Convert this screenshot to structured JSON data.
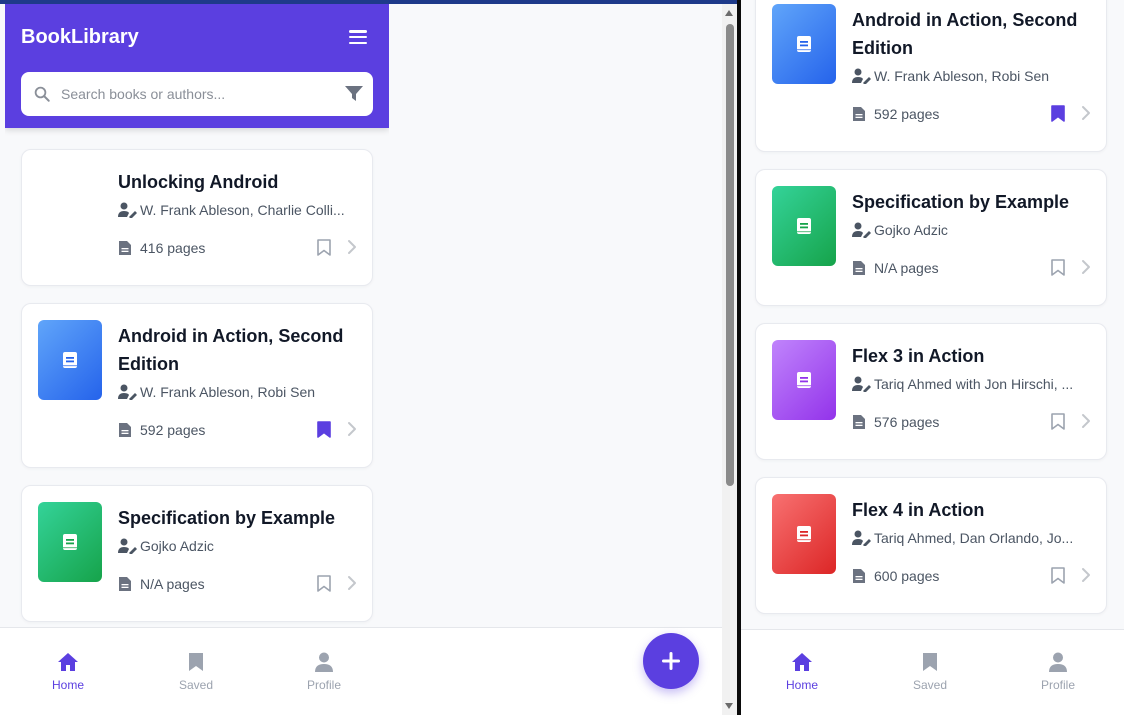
{
  "app": {
    "title": "BookLibrary"
  },
  "search": {
    "placeholder": "Search books or authors..."
  },
  "colors": {
    "primary": "#5b3fe0",
    "text": "#111827",
    "muted": "#4b5563",
    "inactive": "#9ca3af"
  },
  "left_books": [
    {
      "title": "Unlocking Android",
      "authors": "W. Frank Ableson, Charlie Colli...",
      "pages": "416 pages",
      "bookmarked": false,
      "thumb": "none"
    },
    {
      "title": "Android in Action, Second Edition",
      "authors": "W. Frank Ableson, Robi Sen",
      "pages": "592 pages",
      "bookmarked": true,
      "thumb": "blue"
    },
    {
      "title": "Specification by Example",
      "authors": "Gojko Adzic",
      "pages": "N/A pages",
      "bookmarked": false,
      "thumb": "green"
    }
  ],
  "right_books": [
    {
      "title": "Android in Action, Second Edition",
      "authors": "W. Frank Ableson, Robi Sen",
      "pages": "592 pages",
      "bookmarked": true,
      "thumb": "blue"
    },
    {
      "title": "Specification by Example",
      "authors": "Gojko Adzic",
      "pages": "N/A pages",
      "bookmarked": false,
      "thumb": "green"
    },
    {
      "title": "Flex 3 in Action",
      "authors": "Tariq Ahmed with Jon Hirschi, ...",
      "pages": "576 pages",
      "bookmarked": false,
      "thumb": "purple"
    },
    {
      "title": "Flex 4 in Action",
      "authors": "Tariq Ahmed, Dan Orlando, Jo...",
      "pages": "600 pages",
      "bookmarked": false,
      "thumb": "red"
    }
  ],
  "nav": {
    "home": "Home",
    "saved": "Saved",
    "profile": "Profile"
  },
  "thumb_gradients": {
    "blue": [
      "#60a5fa",
      "#2563eb"
    ],
    "green": [
      "#34d399",
      "#16a34a"
    ],
    "purple": [
      "#c084fc",
      "#9333ea"
    ],
    "red": [
      "#f87171",
      "#dc2626"
    ]
  }
}
